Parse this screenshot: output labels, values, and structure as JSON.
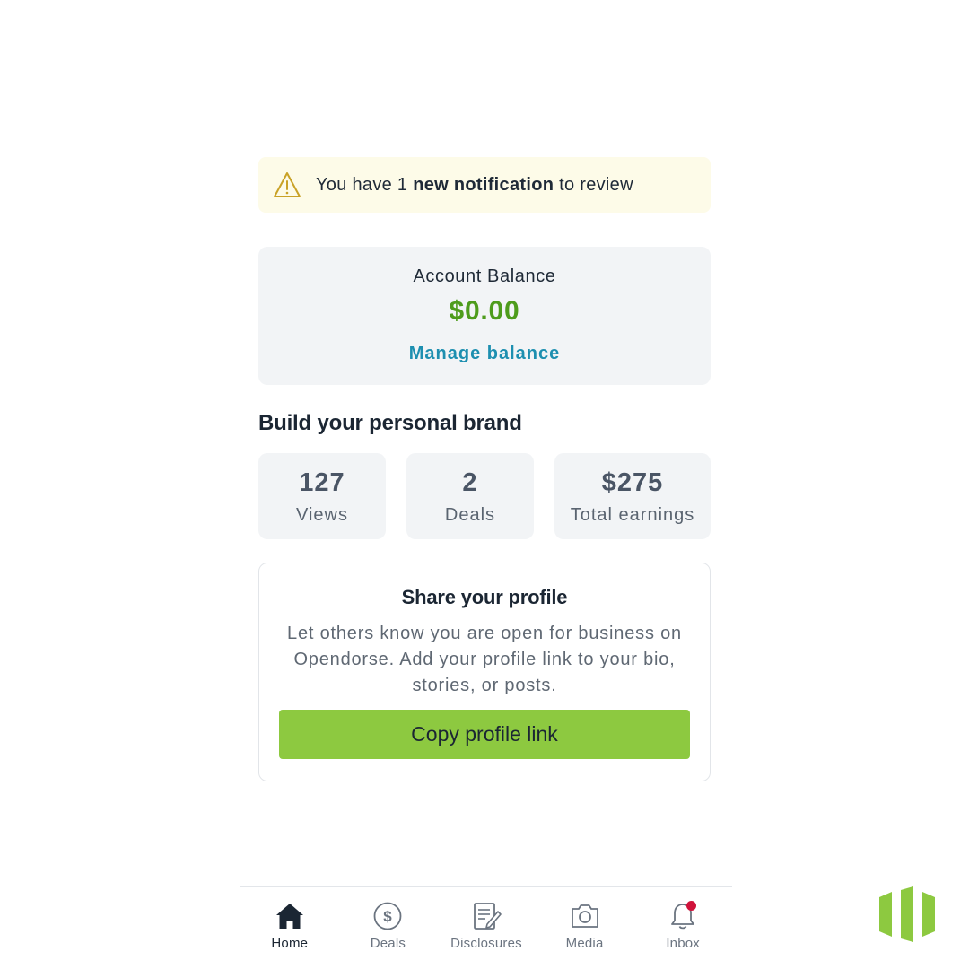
{
  "notification": {
    "prefix": "You have 1 ",
    "bold": "new notification",
    "suffix": " to review",
    "icon": "warning-icon",
    "color": "#c9a227"
  },
  "balance": {
    "label": "Account Balance",
    "amount": "$0.00",
    "link": "Manage balance",
    "amount_color": "#4e9c1c",
    "link_color": "#1d8fb0"
  },
  "brand_section": {
    "title": "Build your personal brand",
    "stats": [
      {
        "value": "127",
        "label": "Views"
      },
      {
        "value": "2",
        "label": "Deals"
      },
      {
        "value": "$275",
        "label": "Total earnings"
      }
    ]
  },
  "share": {
    "title": "Share your profile",
    "description": "Let others know you are open for business on Opendorse. Add your profile link to your bio, stories, or posts.",
    "button": "Copy profile link",
    "button_color": "#8dc940"
  },
  "nav": {
    "items": [
      {
        "label": "Home",
        "icon": "home-icon",
        "active": true
      },
      {
        "label": "Deals",
        "icon": "dollar-circle-icon",
        "active": false
      },
      {
        "label": "Disclosures",
        "icon": "document-edit-icon",
        "active": false
      },
      {
        "label": "Media",
        "icon": "camera-icon",
        "active": false
      },
      {
        "label": "Inbox",
        "icon": "bell-icon",
        "active": false,
        "has_badge": true
      }
    ]
  },
  "brand_logo": {
    "icon": "opendorse-logo-icon",
    "color": "#8dc940"
  }
}
